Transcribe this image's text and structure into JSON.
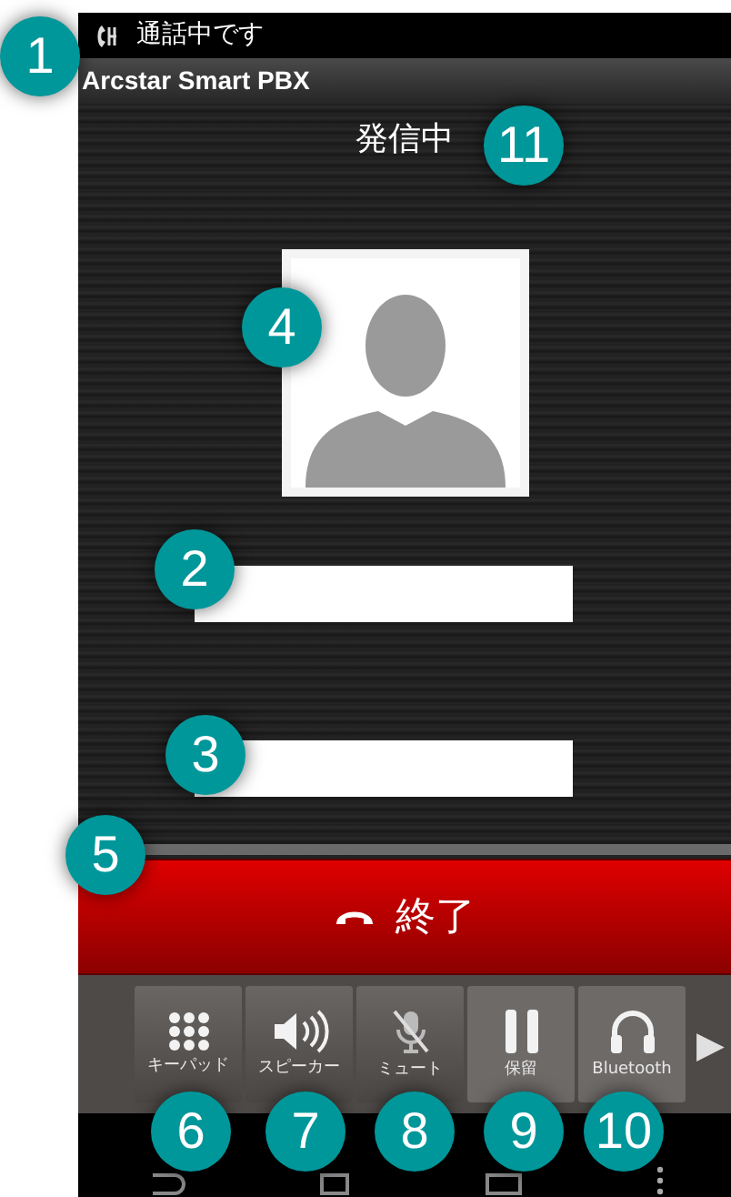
{
  "status_bar": {
    "text": "通話中です"
  },
  "app_bar": {
    "title": "Arcstar Smart PBX"
  },
  "call_status": "発信中",
  "end_button": {
    "label": "終了"
  },
  "controls": [
    {
      "label": "キーパッド",
      "kind": "keypad"
    },
    {
      "label": "スピーカー",
      "kind": "speaker"
    },
    {
      "label": "ミュート",
      "kind": "mute"
    },
    {
      "label": "保留",
      "kind": "hold"
    },
    {
      "label": "Bluetooth",
      "kind": "bluetooth"
    }
  ],
  "more_arrow": "▶",
  "callouts": [
    {
      "label": "1"
    },
    {
      "label": "11"
    },
    {
      "label": "4"
    },
    {
      "label": "2"
    },
    {
      "label": "3"
    },
    {
      "label": "5"
    },
    {
      "label": "6"
    },
    {
      "label": "7"
    },
    {
      "label": "8"
    },
    {
      "label": "9"
    },
    {
      "label": "10"
    }
  ]
}
